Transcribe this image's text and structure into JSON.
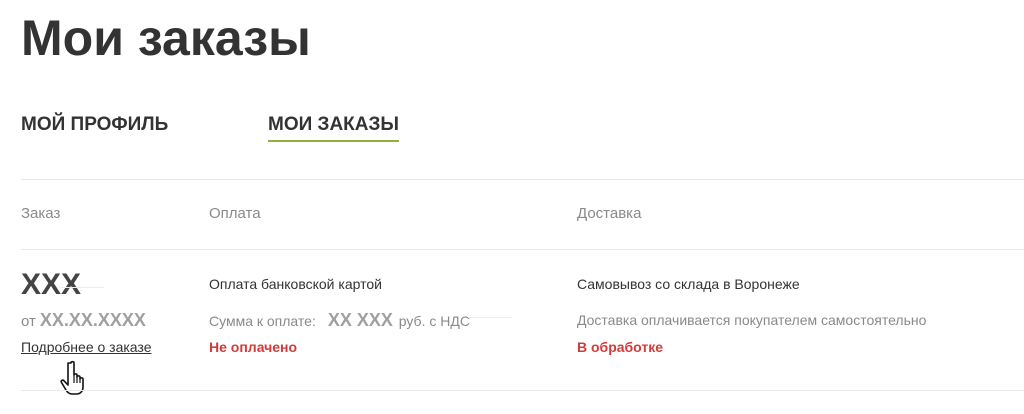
{
  "page": {
    "title": "Мои заказы"
  },
  "tabs": [
    {
      "label": "МОЙ ПРОФИЛЬ",
      "active": false
    },
    {
      "label": "МОИ ЗАКАЗЫ",
      "active": true
    }
  ],
  "table": {
    "headers": {
      "order": "Заказ",
      "payment": "Оплата",
      "delivery": "Доставка"
    }
  },
  "order": {
    "number": "XXX",
    "date_prefix": "от",
    "date": "XX.XX.XXXX",
    "details_link": "Подробнее о заказе",
    "payment": {
      "method": "Оплата банковской картой",
      "sum_label": "Сумма к оплате:",
      "amount": "XX XXX",
      "unit": "руб. с НДС",
      "status": "Не оплачено"
    },
    "delivery": {
      "method": "Самовывоз со склада в Воронеже",
      "note": "Доставка оплачивается покупателем самостоятельно",
      "status": "В обработке"
    }
  },
  "colors": {
    "accent": "#8db33a",
    "status_red": "#d13b3b",
    "muted": "#8a8a8a",
    "text": "#333333"
  },
  "icons": {
    "cursor": "hand-pointer-icon"
  }
}
